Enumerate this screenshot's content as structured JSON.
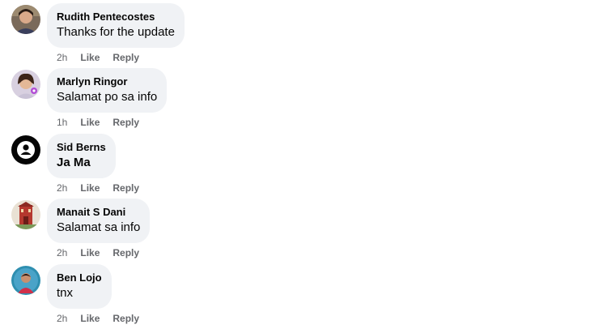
{
  "comments": [
    {
      "author": "Rudith Pentecostes",
      "text": "Thanks for the update",
      "time": "2h",
      "like": "Like",
      "reply": "Reply",
      "avatar": "profile-photo"
    },
    {
      "author": "Marlyn Ringor",
      "text": "Salamat po sa info",
      "time": "1h",
      "like": "Like",
      "reply": "Reply",
      "avatar": "profile-photo"
    },
    {
      "author": "Sid Berns",
      "text": "Ja Ma",
      "time": "2h",
      "like": "Like",
      "reply": "Reply",
      "avatar": "default-user-icon"
    },
    {
      "author": "Manait S Dani",
      "text": "Salamat sa info",
      "time": "2h",
      "like": "Like",
      "reply": "Reply",
      "avatar": "profile-photo"
    },
    {
      "author": "Ben Lojo",
      "text": "tnx",
      "time": "2h",
      "like": "Like",
      "reply": "Reply",
      "avatar": "profile-photo"
    }
  ],
  "colors": {
    "bubble_bg": "#f0f2f5",
    "meta_text": "#65676b",
    "primary_text": "#050505"
  }
}
